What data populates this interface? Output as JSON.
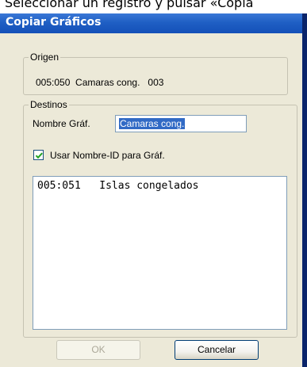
{
  "page_text": "Seleccionar un registro y pulsar «Copia",
  "dialog": {
    "title": "Copiar Gráficos",
    "origin": {
      "legend": "Origen",
      "text": "005:050  Camaras cong.   003"
    },
    "destinations": {
      "legend": "Destinos",
      "name_label": "Nombre Gráf.",
      "name_value": "Camaras cong.",
      "checkbox_label": "Usar Nombre-ID para Gráf.",
      "checkbox_checked": true,
      "list_items": [
        "005:051   Islas congelados"
      ]
    },
    "buttons": {
      "ok": "OK",
      "cancel": "Cancelar"
    }
  }
}
